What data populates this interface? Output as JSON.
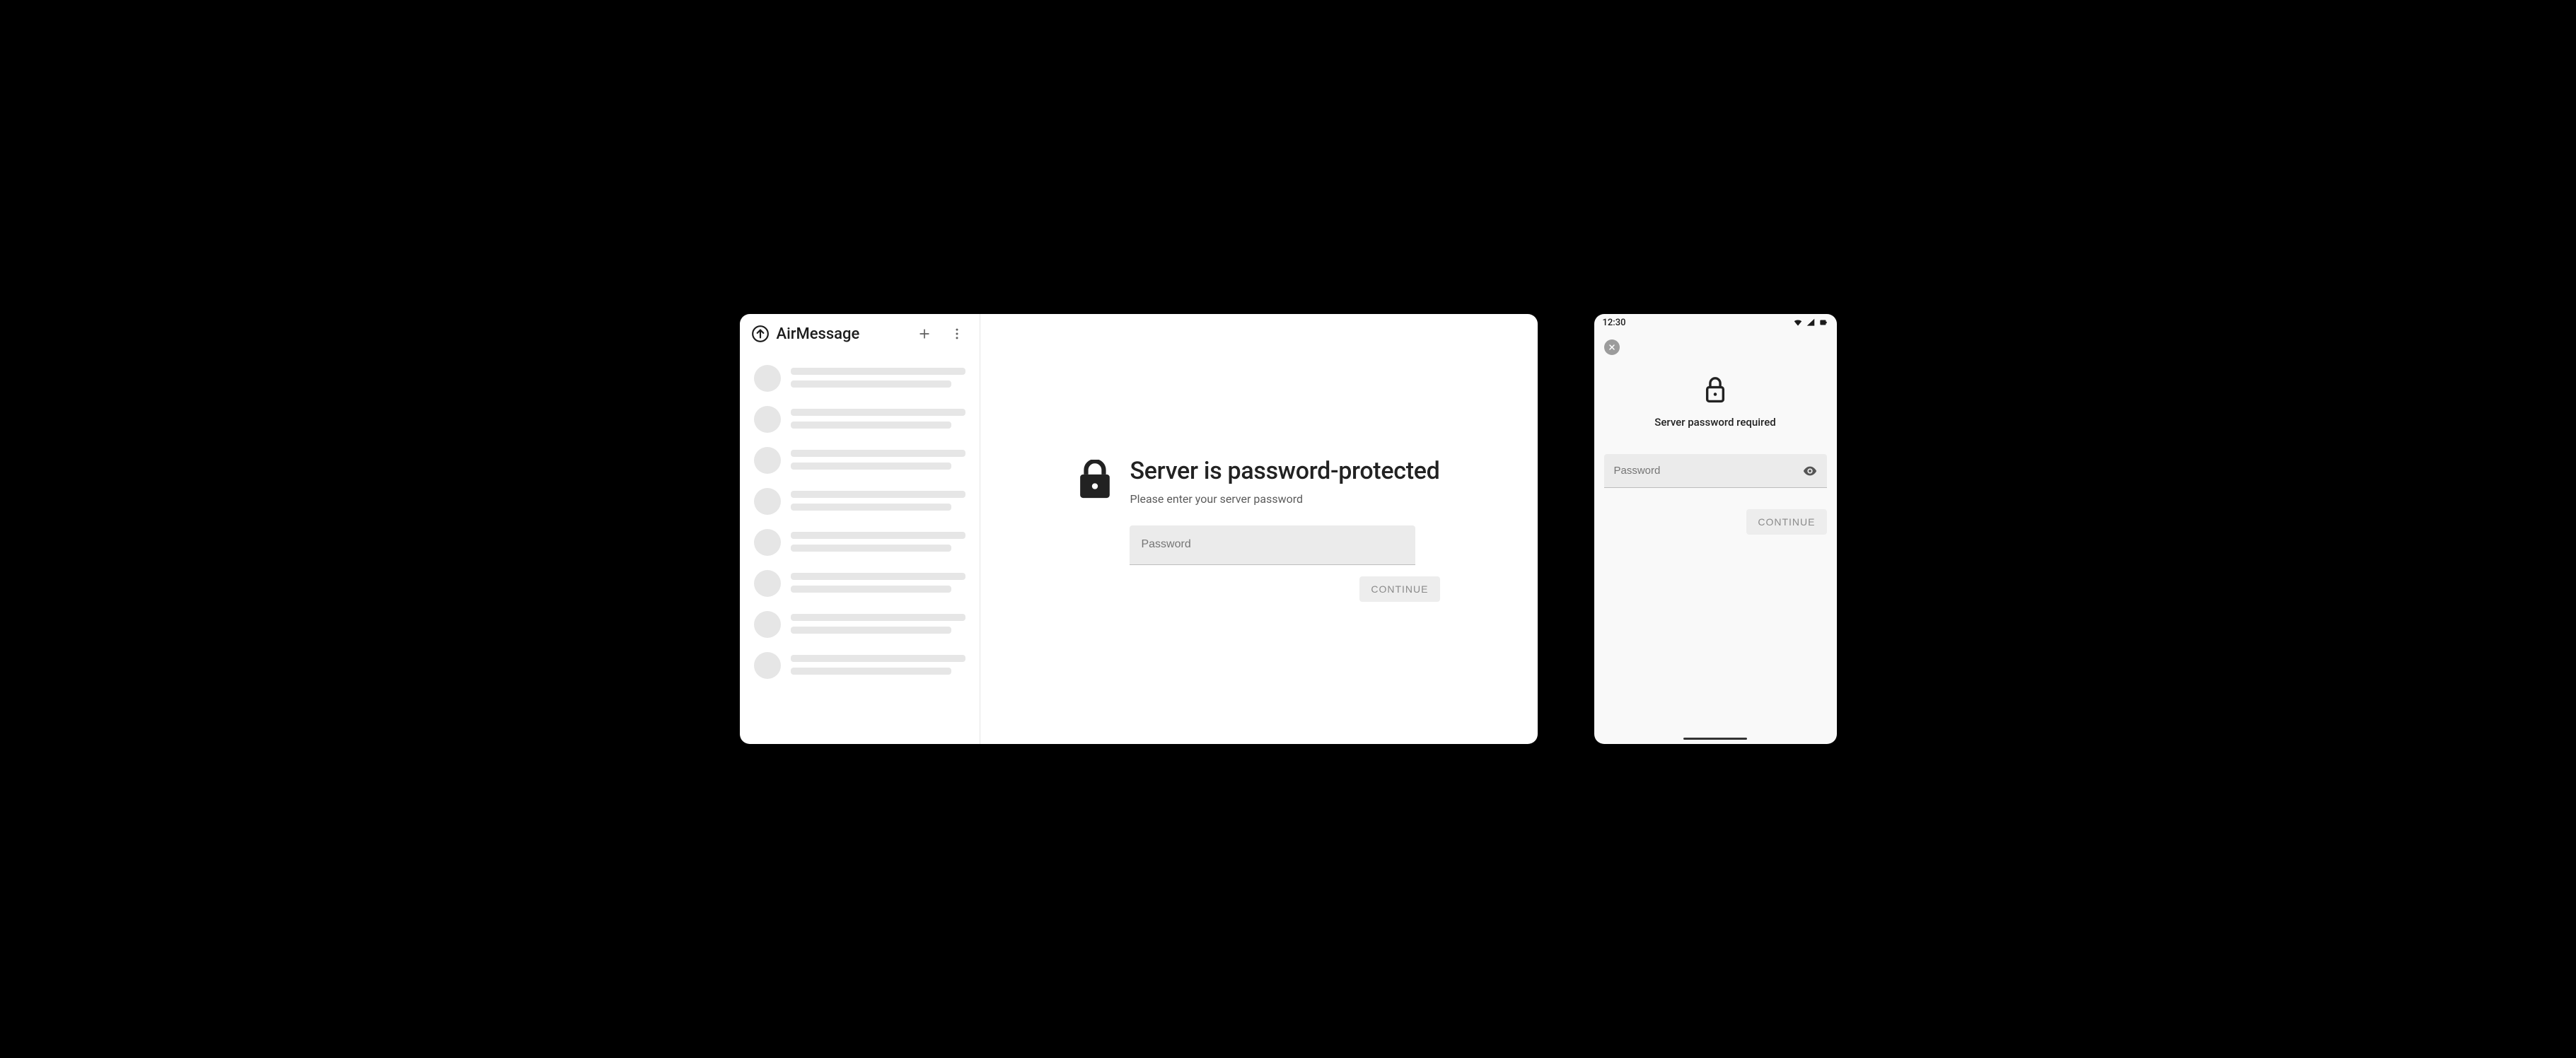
{
  "desktop": {
    "app_title": "AirMessage",
    "main": {
      "title": "Server is password-protected",
      "subtitle": "Please enter your server password",
      "password_placeholder": "Password",
      "continue_label": "CONTINUE"
    },
    "sidebar": {
      "skeleton_row_count": 8
    }
  },
  "mobile": {
    "statusbar": {
      "time": "12:30"
    },
    "title": "Server password required",
    "password_placeholder": "Password",
    "continue_label": "CONTINUE"
  }
}
